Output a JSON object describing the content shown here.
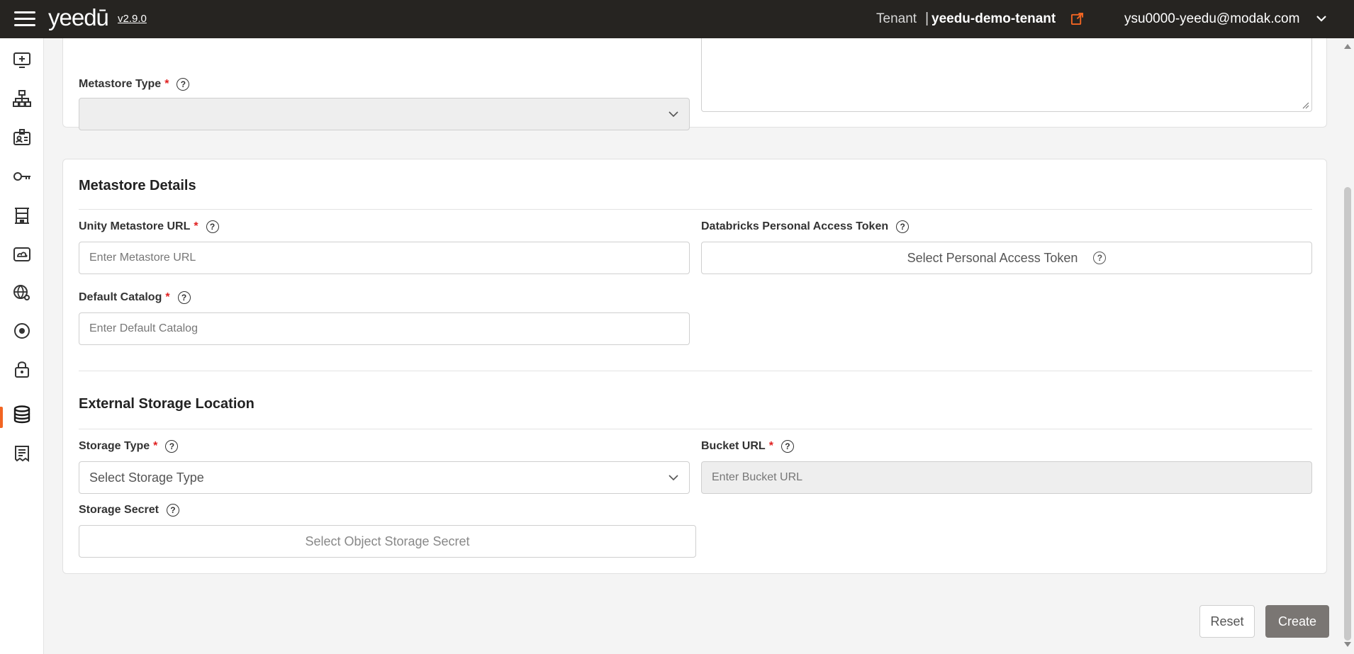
{
  "header": {
    "logo": "yeedū",
    "version": "v2.9.0",
    "tenant_label": "Tenant",
    "tenant_separator": "|",
    "tenant_name": "yeedu-demo-tenant",
    "user_email": "ysu0000-yeedu@modak.com",
    "accent_color": "#f26522"
  },
  "sidebar": {
    "items": [
      {
        "icon": "monitor-plus-icon"
      },
      {
        "icon": "hierarchy-icon"
      },
      {
        "icon": "id-card-icon"
      },
      {
        "icon": "key-icon"
      },
      {
        "icon": "building-icon"
      },
      {
        "icon": "cloud-drive-icon"
      },
      {
        "icon": "globe-settings-icon"
      },
      {
        "icon": "target-icon"
      },
      {
        "icon": "lock-icon"
      },
      {
        "icon": "database-icon",
        "active": true
      },
      {
        "icon": "document-list-icon"
      }
    ]
  },
  "metastore_basic": {
    "type_label": "Metastore Type",
    "type_required": "*",
    "type_value": ""
  },
  "metastore_details": {
    "title": "Metastore Details",
    "url_label": "Unity Metastore URL",
    "url_required": "*",
    "url_placeholder": "Enter Metastore URL",
    "token_label": "Databricks Personal Access Token",
    "token_button": "Select Personal Access Token",
    "catalog_label": "Default Catalog",
    "catalog_required": "*",
    "catalog_placeholder": "Enter Default Catalog"
  },
  "external_storage": {
    "title": "External Storage Location",
    "type_label": "Storage Type",
    "type_required": "*",
    "type_placeholder": "Select Storage Type",
    "bucket_label": "Bucket URL",
    "bucket_required": "*",
    "bucket_placeholder": "Enter Bucket URL",
    "secret_label": "Storage Secret",
    "secret_button": "Select Object Storage Secret"
  },
  "actions": {
    "reset": "Reset",
    "create": "Create"
  }
}
